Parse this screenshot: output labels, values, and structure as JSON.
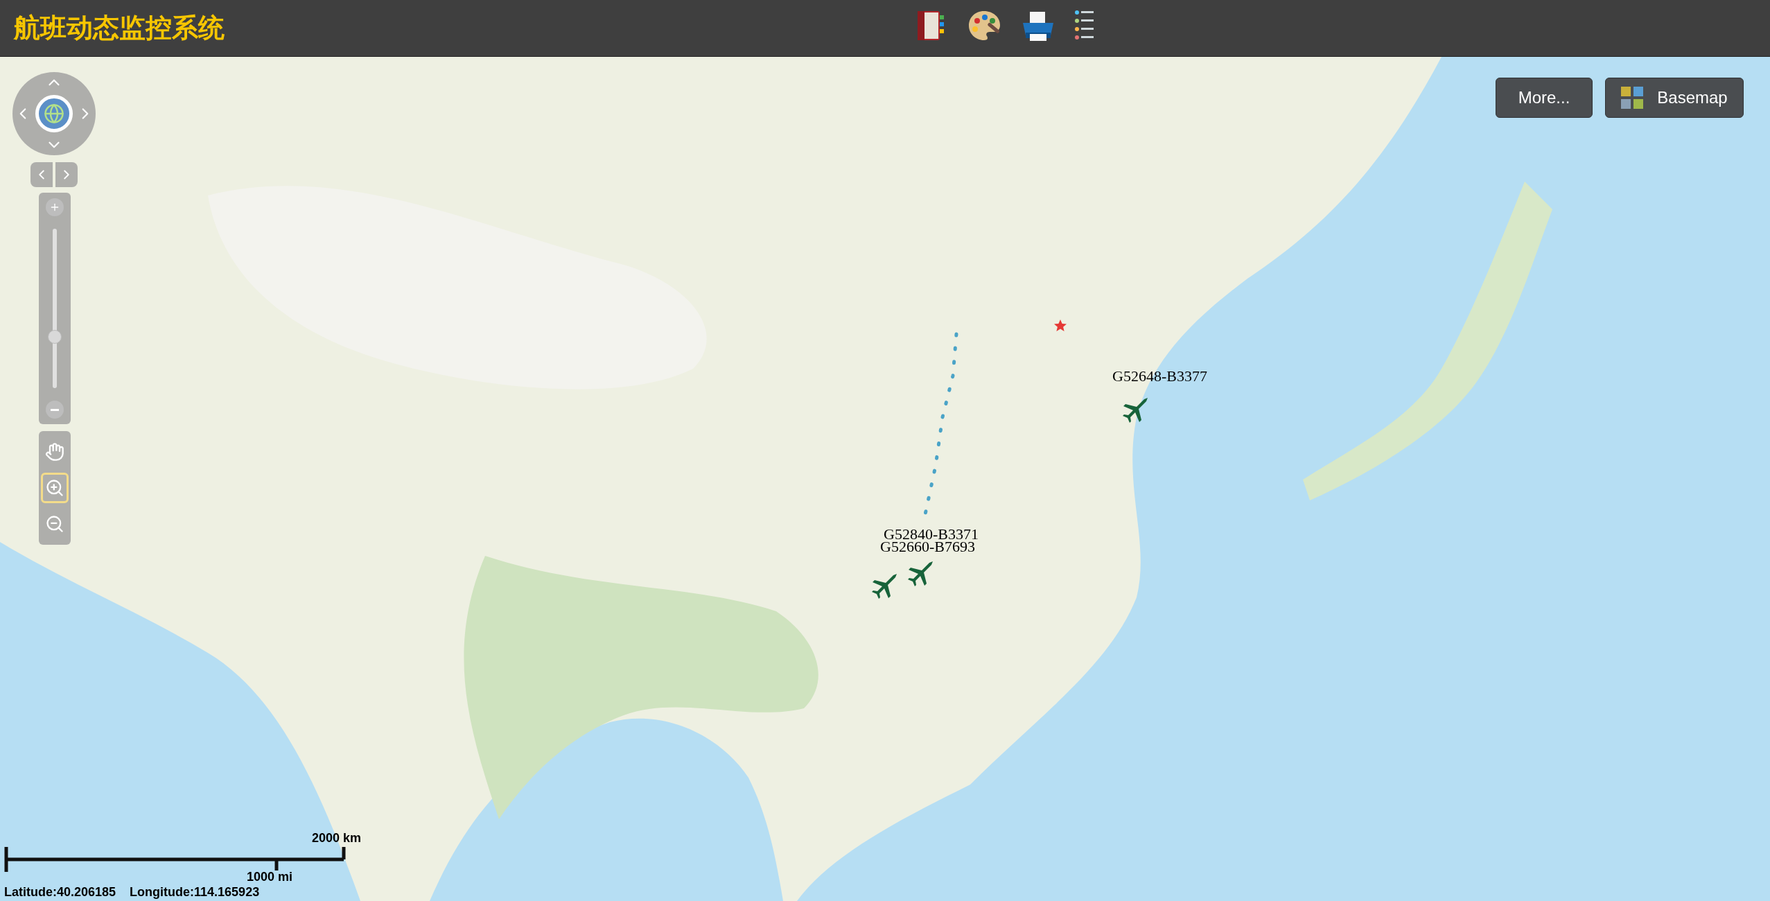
{
  "header": {
    "title": "航班动态监控系统"
  },
  "map_buttons": {
    "more": "More...",
    "basemap": "Basemap"
  },
  "zoom_slider": {
    "level": 0.32
  },
  "tools": [
    {
      "kind": "pan",
      "selected": false
    },
    {
      "kind": "zoom-in",
      "selected": true
    },
    {
      "kind": "zoom-out",
      "selected": false
    }
  ],
  "flights": [
    {
      "label": "G52648-B3377"
    },
    {
      "label": "G52840-B3371"
    },
    {
      "label": "G52660-B7693"
    }
  ],
  "scale_bar": {
    "metric": "2000 km",
    "imperial": "1000 mi"
  },
  "coordinates": {
    "latitude": "Latitude:40.206185",
    "longitude": "Longitude:114.165923"
  }
}
